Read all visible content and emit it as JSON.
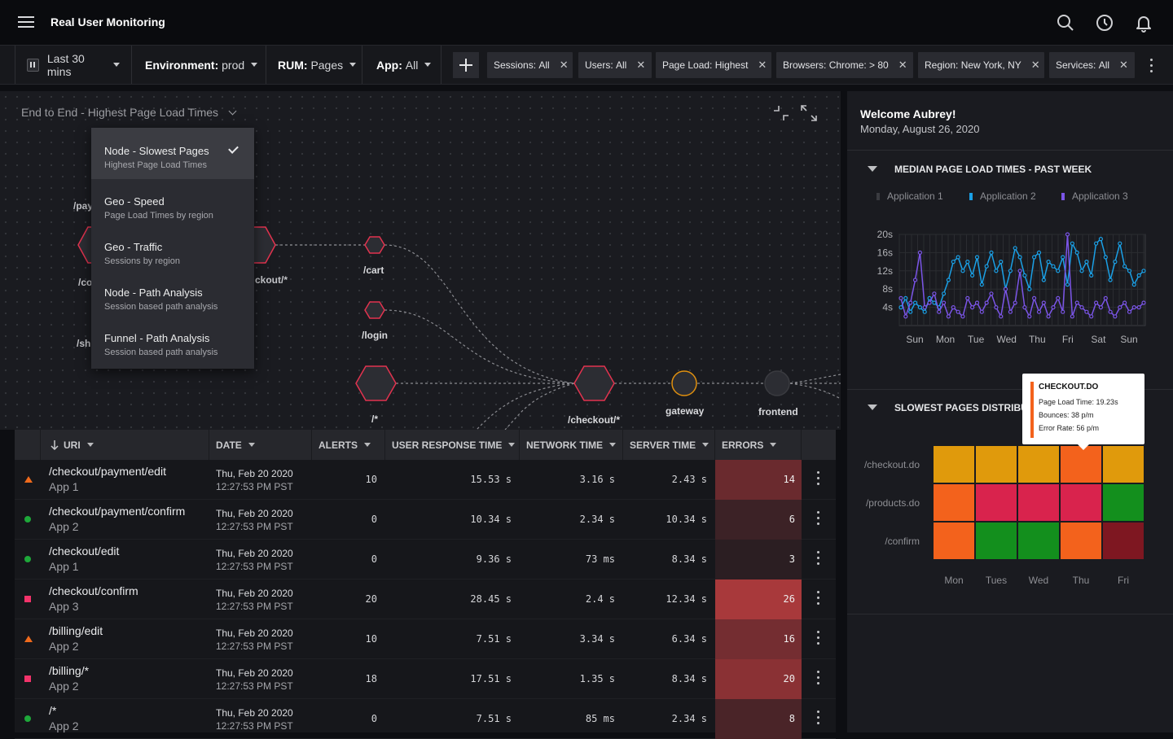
{
  "header": {
    "title": "Real User Monitoring",
    "icons": [
      "search-icon",
      "clock-icon",
      "bell-icon"
    ]
  },
  "filters": {
    "time_range": "Last 30 mins",
    "environment_label": "Environment:",
    "environment_value": "prod",
    "rum_label": "RUM:",
    "rum_value": "Pages",
    "app_label": "App:",
    "app_value": "All",
    "chips": [
      {
        "label": "Sessions:",
        "value": "All"
      },
      {
        "label": "Users:",
        "value": "All"
      },
      {
        "label": "Page Load:",
        "value": "Highest"
      },
      {
        "label": "Browsers:",
        "value": "Chrome: > 80"
      },
      {
        "label": "Region:",
        "value": "New York, NY"
      },
      {
        "label": "Services:",
        "value": "All"
      }
    ]
  },
  "graph": {
    "title": "End to End - Highest Page Load Times",
    "nodes": {
      "cart": "/cart",
      "login": "/login",
      "root": "/*",
      "checkout": "/checkout/*",
      "gateway": "gateway",
      "frontend": "frontend",
      "partial_checkout": "ckout/*",
      "partial_pay": "/pay",
      "partial_co": "/co",
      "partial_sh": "/sh"
    }
  },
  "dropdown": {
    "items": [
      {
        "title": "Node - Slowest Pages",
        "sub": "Highest Page Load Times",
        "selected": true
      },
      {
        "title": "Geo - Speed",
        "sub": "Page Load Times by region",
        "selected": false
      },
      {
        "title": "Geo - Traffic",
        "sub": "Sessions by region",
        "selected": false
      },
      {
        "title": "Node - Path Analysis",
        "sub": "Session based path analysis",
        "selected": false
      },
      {
        "title": "Funnel - Path Analysis",
        "sub": "Session based path analysis",
        "selected": false
      }
    ]
  },
  "table": {
    "columns": [
      "URI",
      "DATE",
      "ALERTS",
      "USER RESPONSE TIME",
      "NETWORK TIME",
      "SERVER TIME",
      "ERRORS"
    ],
    "rows": [
      {
        "status": "warning",
        "uri": "/checkout/payment/edit",
        "app": "App 1",
        "date": "Thu, Feb 20 2020",
        "time": "12:27:53 PM PST",
        "alerts": "10",
        "urt": "15.53 s",
        "net": "3.16 s",
        "server": "2.43 s",
        "errors": "14",
        "err_color": "#6a2a2e"
      },
      {
        "status": "ok",
        "uri": "/checkout/payment/confirm",
        "app": "App 2",
        "date": "Thu, Feb 20 2020",
        "time": "12:27:53 PM PST",
        "alerts": "0",
        "urt": "10.34 s",
        "net": "2.34 s",
        "server": "10.34 s",
        "errors": "6",
        "err_color": "#3c2226"
      },
      {
        "status": "ok",
        "uri": "/checkout/edit",
        "app": "App 1",
        "date": "Thu, Feb 20 2020",
        "time": "12:27:53 PM PST",
        "alerts": "0",
        "urt": "9.36 s",
        "net": "73 ms",
        "server": "8.34 s",
        "errors": "3",
        "err_color": "#2b1e22"
      },
      {
        "status": "critical",
        "uri": "/checkout/confirm",
        "app": "App 3",
        "date": "Thu, Feb 20 2020",
        "time": "12:27:53 PM PST",
        "alerts": "20",
        "urt": "28.45 s",
        "net": "2.4 s",
        "server": "12.34 s",
        "errors": "26",
        "err_color": "#a8393b"
      },
      {
        "status": "warning",
        "uri": "/billing/edit",
        "app": "App 2",
        "date": "Thu, Feb 20 2020",
        "time": "12:27:53 PM PST",
        "alerts": "10",
        "urt": "7.51 s",
        "net": "3.34 s",
        "server": "6.34 s",
        "errors": "16",
        "err_color": "#742d31"
      },
      {
        "status": "critical",
        "uri": "/billing/*",
        "app": "App 2",
        "date": "Thu, Feb 20 2020",
        "time": "12:27:53 PM PST",
        "alerts": "18",
        "urt": "17.51 s",
        "net": "1.35 s",
        "server": "8.34 s",
        "errors": "20",
        "err_color": "#8a3134"
      },
      {
        "status": "ok",
        "uri": "/*",
        "app": "App 2",
        "date": "Thu, Feb 20 2020",
        "time": "12:27:53 PM PST",
        "alerts": "0",
        "urt": "7.51 s",
        "net": "85 ms",
        "server": "2.34 s",
        "errors": "8",
        "err_color": "#4a2428"
      }
    ]
  },
  "sidebar": {
    "welcome": "Welcome Aubrey!",
    "date": "Monday, August 26, 2020",
    "median_title": "MEDIAN PAGE LOAD TIMES - PAST WEEK",
    "slowest_title": "SLOWEST PAGES DISTRIBUT",
    "legend": [
      {
        "name": "Application 1",
        "color": "#3a3b40"
      },
      {
        "name": "Application 2",
        "color": "#1aa0e6"
      },
      {
        "name": "Application 3",
        "color": "#7b55e8"
      }
    ],
    "tooltip": {
      "title": "CHECKOUT.DO",
      "line1": "Page Load Time: 19.23s",
      "line2": "Bounces: 38 p/m",
      "line3": "Error Rate: 56 p/m"
    }
  },
  "chart_data": [
    {
      "type": "line",
      "title": "MEDIAN PAGE LOAD TIMES - PAST WEEK",
      "x_tick_labels": [
        "Sun",
        "Mon",
        "Tue",
        "Wed",
        "Thu",
        "Fri",
        "Sat",
        "Sun"
      ],
      "y_tick_labels": [
        "20s",
        "16s",
        "12s",
        "8s",
        "4s"
      ],
      "ylim": [
        0,
        20
      ],
      "grid": true,
      "series": [
        {
          "name": "Application 2",
          "color": "#1aa0e6",
          "values": [
            4,
            6,
            3,
            5,
            4,
            3,
            6,
            5,
            4,
            7,
            10,
            14,
            15,
            12,
            14,
            11,
            15,
            9,
            13,
            16,
            12,
            14,
            8,
            12,
            17,
            15,
            11,
            8,
            15,
            16,
            10,
            14,
            13,
            12,
            15,
            9,
            18,
            16,
            12,
            14,
            11,
            18,
            19,
            15,
            10,
            14,
            18,
            13,
            12,
            9,
            11,
            12
          ]
        },
        {
          "name": "Application 3",
          "color": "#7b55e8",
          "values": [
            6,
            2,
            5,
            10,
            16,
            4,
            5,
            7,
            3,
            5,
            2,
            4,
            3,
            2,
            6,
            4,
            5,
            3,
            5,
            7,
            4,
            2,
            8,
            3,
            5,
            12,
            4,
            2,
            6,
            3,
            5,
            2,
            4,
            6,
            3,
            20,
            2,
            5,
            4,
            3,
            2,
            5,
            4,
            6,
            3,
            2,
            4,
            5,
            3,
            4,
            4,
            5
          ]
        }
      ]
    },
    {
      "type": "heatmap",
      "title": "SLOWEST PAGES DISTRIBUT",
      "rows": [
        "/checkout.do",
        "/products.do",
        "/confirm"
      ],
      "columns": [
        "Mon",
        "Tues",
        "Wed",
        "Thu",
        "Fri"
      ],
      "colors": [
        [
          "#e09a0c",
          "#e09a0c",
          "#e09a0c",
          "#f3621c",
          "#e09a0c"
        ],
        [
          "#f3621c",
          "#d9234d",
          "#d9234d",
          "#d9234d",
          "#138f1d"
        ],
        [
          "#f3621c",
          "#138f1d",
          "#138f1d",
          "#f3621c",
          "#7e1721"
        ]
      ]
    }
  ]
}
